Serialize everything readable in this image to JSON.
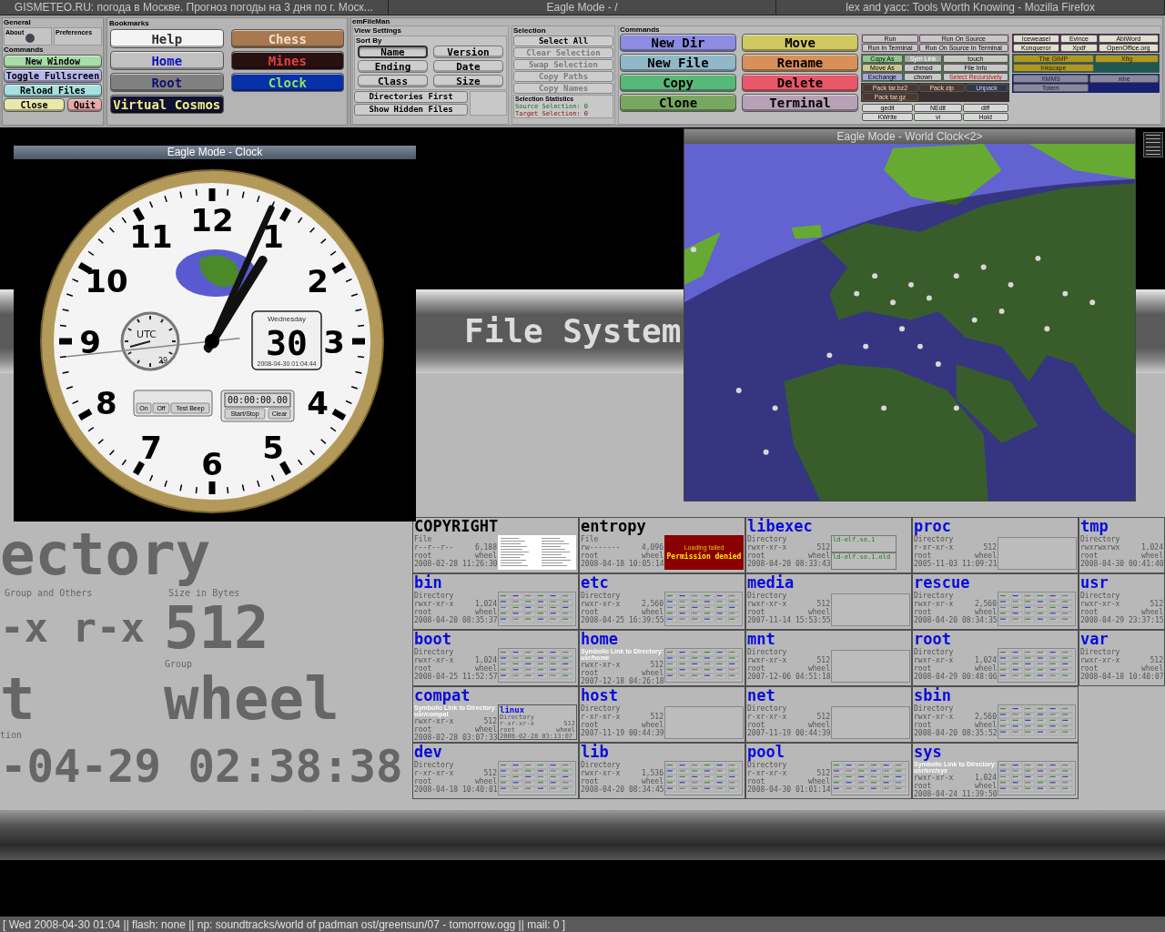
{
  "title_bar": {
    "titles": [
      "GISMETEO.RU: погода в Москве. Прогноз погоды на 3 дня по г. Моск...",
      "Eagle Mode - /",
      "lex and yacc: Tools Worth Knowing - Mozilla Firefox"
    ]
  },
  "control_panel": {
    "general": {
      "title": "General",
      "about": "About",
      "preferences": "Preferences",
      "commands_title": "Commands",
      "buttons": [
        {
          "label": "New Window",
          "color": "#a8dca8"
        },
        {
          "label": "Toggle Fullscreen",
          "color": "#b8b8f0"
        },
        {
          "label": "Reload Files",
          "color": "#a8e0e0"
        },
        {
          "label": "Close",
          "color": "#e8e8a8"
        },
        {
          "label": "Quit",
          "color": "#e8a8a8"
        }
      ]
    },
    "bookmarks": {
      "title": "Bookmarks",
      "buttons": [
        {
          "label": "Help",
          "color": "#f4f4f4"
        },
        {
          "label": "Chess",
          "color": "#a87850"
        },
        {
          "label": "Home",
          "color": "#c0c0c0"
        },
        {
          "label": "Mines",
          "color": "#281010"
        },
        {
          "label": "Root",
          "color": "#808080"
        },
        {
          "label": "Clock",
          "color": "#0830a8"
        },
        {
          "label": "Virtual Cosmos",
          "color": "#101030"
        }
      ]
    },
    "file_manager": {
      "title": "emFileMan",
      "view_settings": {
        "title": "View Settings",
        "sort_title": "Sort By",
        "sort_buttons": [
          {
            "label": "Name",
            "selected": true
          },
          {
            "label": "Version",
            "selected": false
          },
          {
            "label": "Ending",
            "selected": false
          },
          {
            "label": "Date",
            "selected": false
          },
          {
            "label": "Class",
            "selected": false
          },
          {
            "label": "Size",
            "selected": false
          }
        ],
        "toggles": [
          "Directories First",
          "Show Hidden Files"
        ]
      },
      "selection": {
        "title": "Selection",
        "buttons": [
          {
            "label": "Select All",
            "disabled": false
          },
          {
            "label": "Clear Selection",
            "disabled": true
          },
          {
            "label": "Swap Selection",
            "disabled": true
          },
          {
            "label": "Copy Paths",
            "disabled": true
          },
          {
            "label": "Copy Names",
            "disabled": true
          }
        ],
        "stats_title": "Selection Statistics",
        "source": "Source Selection: 0",
        "target": "Target Selection: 0"
      },
      "commands": {
        "title": "Commands",
        "buttons": [
          {
            "label": "New Dir",
            "color": "#8c8ce0"
          },
          {
            "label": "Move",
            "color": "#d0c860"
          },
          {
            "label": "New File",
            "color": "#90b8c8"
          },
          {
            "label": "Rename",
            "color": "#d89058"
          },
          {
            "label": "Copy",
            "color": "#58b878"
          },
          {
            "label": "Delete",
            "color": "#e85868"
          },
          {
            "label": "Clone",
            "color": "#78a860"
          },
          {
            "label": "Terminal",
            "color": "#b8a0b8"
          }
        ],
        "left_groups": [
          {
            "color": "#b890a8",
            "buttons": [
              {
                "label": "Run",
                "color": "#c8c8c8"
              },
              {
                "label": "Run On Source",
                "color": "#c8c8c8"
              },
              {
                "label": "Run In Terminal",
                "color": "#c8c8c8"
              },
              {
                "label": "Run On Source In Terminal",
                "color": "#c8c8c8"
              }
            ]
          },
          {
            "color": "#507050",
            "buttons": [
              {
                "label": "Copy As",
                "color": "#90c890"
              },
              {
                "label": "Sym Link",
                "color": "#a8a8a8"
              },
              {
                "label": "touch",
                "color": "#c8c8c8"
              },
              {
                "label": "Move As",
                "color": "#c8c890"
              },
              {
                "label": "chmod",
                "color": "#c8c8c8"
              },
              {
                "label": "File Info",
                "color": "#c8c8c8"
              },
              {
                "label": "Exchange",
                "color": "#a8a8d8"
              },
              {
                "label": "chown",
                "color": "#c8c8c8"
              },
              {
                "label": "Select Recursively",
                "color": "#c8c8c8"
              }
            ]
          },
          {
            "color": "#383030",
            "buttons": [
              {
                "label": "Pack tar.bz2",
                "color": "#4a3830"
              },
              {
                "label": "Pack zip",
                "color": "#4a3830"
              },
              {
                "label": "Unpack",
                "color": "#303848"
              },
              {
                "label": "Pack tar.gz",
                "color": "#4a3830"
              }
            ]
          },
          {
            "color": "#b8c8b8",
            "buttons": [
              {
                "label": "gedit",
                "color": "#d8d8d8"
              },
              {
                "label": "NEdit",
                "color": "#d8d8d8"
              },
              {
                "label": "diff",
                "color": "#d8d8d8"
              },
              {
                "label": "KWrite",
                "color": "#d8d8d8"
              },
              {
                "label": "vi",
                "color": "#d8d8d8"
              },
              {
                "label": "Hold",
                "color": "#d8d8d8"
              }
            ]
          }
        ],
        "right_groups": [
          {
            "color": "#502848",
            "buttons": [
              {
                "label": "Iceweasel",
                "color": "#e0e0d0"
              },
              {
                "label": "Evince",
                "color": "#e0e0d0"
              },
              {
                "label": "AbiWord",
                "color": "#e0e0d0"
              },
              {
                "label": "Konqueror",
                "color": "#e0e0d0"
              },
              {
                "label": "Xpdf",
                "color": "#e0e0d0"
              },
              {
                "label": "OpenOffice.org",
                "color": "#e0e0d0"
              }
            ]
          },
          {
            "color": "#205850",
            "buttons": [
              {
                "label": "The GIMP",
                "color": "#b09820"
              },
              {
                "label": "Xfig",
                "color": "#b09820"
              },
              {
                "label": "Inkscape",
                "color": "#b09820"
              }
            ]
          },
          {
            "color": "#1a2070",
            "buttons": [
              {
                "label": "XMMS",
                "color": "#8888a0"
              },
              {
                "label": "xine",
                "color": "#8888a0"
              },
              {
                "label": "Totem",
                "color": "#8888a0"
              }
            ]
          }
        ]
      }
    }
  },
  "clock_window": {
    "title": "Eagle Mode - Clock",
    "numerals": [
      "12",
      "1",
      "2",
      "3",
      "4",
      "5",
      "6",
      "7",
      "8",
      "9",
      "10",
      "11"
    ],
    "weekday": "Wednesday",
    "day": "30",
    "date_time": "2008-04-30 01:04:44",
    "utc_label": "UTC",
    "utc_day": "29",
    "alarm_buttons": [
      "On",
      "Off",
      "Test Beep"
    ],
    "stopwatch": "00:00:00.00",
    "stopwatch_buttons": [
      "Start/Stop",
      "Clear"
    ]
  },
  "world_clock_window": {
    "title": "Eagle Mode - World Clock<2>"
  },
  "file_system": {
    "title": "File System",
    "detail": {
      "type_fragment": "ectory",
      "perm_label": "Group and Others",
      "perm_value": "-x r-x",
      "size_label": "Size in Bytes",
      "size_value": "512",
      "owner_fragment": "t",
      "group_label": "Group",
      "group_value": "wheel",
      "date_label": "tion",
      "date_value": "-04-29 02:38:38"
    },
    "entries": [
      {
        "name": "COPYRIGHT",
        "kind": "file",
        "type": "File",
        "perms": "r--r--r--",
        "size": "6,188",
        "owner": "root",
        "group": "wheel",
        "date": "2008-02-28 11:26:30",
        "preview": {
          "kind": "document"
        }
      },
      {
        "name": "bin",
        "kind": "directory",
        "type": "Directory",
        "perms": "rwxr-xr-x",
        "size": "1,024",
        "owner": "root",
        "group": "wheel",
        "date": "2008-04-20 08:35:37",
        "preview": {
          "kind": "listing"
        }
      },
      {
        "name": "boot",
        "kind": "directory",
        "type": "Directory",
        "perms": "rwxr-xr-x",
        "size": "1,024",
        "owner": "root",
        "group": "wheel",
        "date": "2008-04-25 11:52:57",
        "preview": {
          "kind": "listing"
        }
      },
      {
        "name": "compat",
        "kind": "link",
        "type": "Symbolic Link to Directory: usr/compat",
        "perms": "rwxr-xr-x",
        "size": "512",
        "owner": "root",
        "group": "wheel",
        "date": "2008-02-28 03:07:33",
        "preview": {
          "kind": "nested",
          "name": "linux",
          "type": "Directory",
          "perms": "r-xr-xr-x",
          "size": "512",
          "owner": "root",
          "group": "wheel",
          "date": "2008-02-28 03:13:07"
        }
      },
      {
        "name": "dev",
        "kind": "directory",
        "type": "Directory",
        "perms": "r-xr-xr-x",
        "size": "512",
        "owner": "root",
        "group": "wheel",
        "date": "2008-04-18 10:40:01",
        "preview": {
          "kind": "listing"
        }
      },
      {
        "name": "entropy",
        "kind": "file",
        "type": "File",
        "perms": "rw-------",
        "size": "4,096",
        "owner": "root",
        "group": "wheel",
        "date": "2008-04-18 10:05:14",
        "preview": {
          "kind": "error",
          "note": "Loading failed",
          "message": "Permission denied"
        }
      },
      {
        "name": "etc",
        "kind": "directory",
        "type": "Directory",
        "perms": "rwxr-xr-x",
        "size": "2,560",
        "owner": "root",
        "group": "wheel",
        "date": "2008-04-25 16:39:55",
        "preview": {
          "kind": "listing"
        }
      },
      {
        "name": "home",
        "kind": "link",
        "type": "Symbolic Link to Directory: usr/home",
        "perms": "rwxr-xr-x",
        "size": "512",
        "owner": "root",
        "group": "wheel",
        "date": "2007-12-18 04:26:18",
        "preview": {
          "kind": "listing"
        }
      },
      {
        "name": "host",
        "kind": "directory",
        "type": "Directory",
        "perms": "r-xr-xr-x",
        "size": "512",
        "owner": "root",
        "group": "wheel",
        "date": "2007-11-19 00:44:39",
        "preview": {
          "kind": "empty"
        }
      },
      {
        "name": "lib",
        "kind": "directory",
        "type": "Directory",
        "perms": "rwxr-xr-x",
        "size": "1,536",
        "owner": "root",
        "group": "wheel",
        "date": "2008-04-20 08:34:45",
        "preview": {
          "kind": "listing"
        }
      },
      {
        "name": "libexec",
        "kind": "directory",
        "type": "Directory",
        "perms": "rwxr-xr-x",
        "size": "512",
        "owner": "root",
        "group": "wheel",
        "date": "2008-04-20 08:33:43",
        "preview": {
          "kind": "entries",
          "items": [
            "ld-elf.so.1",
            "ld-elf.so.1.old"
          ]
        }
      },
      {
        "name": "media",
        "kind": "directory",
        "type": "Directory",
        "perms": "rwxr-xr-x",
        "size": "512",
        "owner": "root",
        "group": "wheel",
        "date": "2007-11-14 15:53:55",
        "preview": {
          "kind": "empty"
        }
      },
      {
        "name": "mnt",
        "kind": "directory",
        "type": "Directory",
        "perms": "rwxr-xr-x",
        "size": "512",
        "owner": "root",
        "group": "wheel",
        "date": "2007-12-06 04:51:18",
        "preview": {
          "kind": "empty"
        }
      },
      {
        "name": "net",
        "kind": "directory",
        "type": "Directory",
        "perms": "r-xr-xr-x",
        "size": "512",
        "owner": "root",
        "group": "wheel",
        "date": "2007-11-19 00:44:39",
        "preview": {
          "kind": "empty"
        }
      },
      {
        "name": "pool",
        "kind": "directory",
        "type": "Directory",
        "perms": "r-xr-xr-x",
        "size": "512",
        "owner": "root",
        "group": "wheel",
        "date": "2008-04-30 01:01:14",
        "preview": {
          "kind": "listing"
        }
      },
      {
        "name": "proc",
        "kind": "directory",
        "type": "Directory",
        "perms": "r-xr-xr-x",
        "size": "512",
        "owner": "root",
        "group": "wheel",
        "date": "2005-11-03 11:09:21",
        "preview": {
          "kind": "empty"
        }
      },
      {
        "name": "rescue",
        "kind": "directory",
        "type": "Directory",
        "perms": "rwxr-xr-x",
        "size": "2,560",
        "owner": "root",
        "group": "wheel",
        "date": "2008-04-20 08:34:35",
        "preview": {
          "kind": "listing"
        }
      },
      {
        "name": "root",
        "kind": "directory",
        "type": "Directory",
        "perms": "rwxr-xr-x",
        "size": "1,024",
        "owner": "root",
        "group": "wheel",
        "date": "2008-04-29 00:48:06",
        "preview": {
          "kind": "listing"
        }
      },
      {
        "name": "sbin",
        "kind": "directory",
        "type": "Directory",
        "perms": "rwxr-xr-x",
        "size": "2,560",
        "owner": "root",
        "group": "wheel",
        "date": "2008-04-20 08:35:52",
        "preview": {
          "kind": "listing"
        }
      },
      {
        "name": "sys",
        "kind": "link",
        "type": "Symbolic Link to Directory: usr/src/sys",
        "perms": "rwxr-xr-x",
        "size": "1,024",
        "owner": "root",
        "group": "wheel",
        "date": "2008-04-24 11:39:50",
        "preview": {
          "kind": "listing"
        }
      },
      {
        "name": "tmp",
        "kind": "directory",
        "type": "Directory",
        "perms": "rwxrwxrwx",
        "size": "1,024",
        "owner": "root",
        "group": "wheel",
        "date": "2008-04-30 00:41:40"
      },
      {
        "name": "usr",
        "kind": "directory",
        "type": "Directory",
        "perms": "rwxr-xr-x",
        "size": "512",
        "owner": "root",
        "group": "wheel",
        "date": "2008-04-29 23:37:15"
      },
      {
        "name": "var",
        "kind": "directory",
        "type": "Directory",
        "perms": "rwxr-xr-x",
        "size": "512",
        "owner": "root",
        "group": "wheel",
        "date": "2008-04-18 10:40:07"
      }
    ]
  },
  "status_bar": {
    "text": "[ Wed 2008-04-30 01:04 || flash: none || np: soundtracks/world of padman ost/greensun/07 - tomorrow.ogg || mail: 0 ]"
  }
}
